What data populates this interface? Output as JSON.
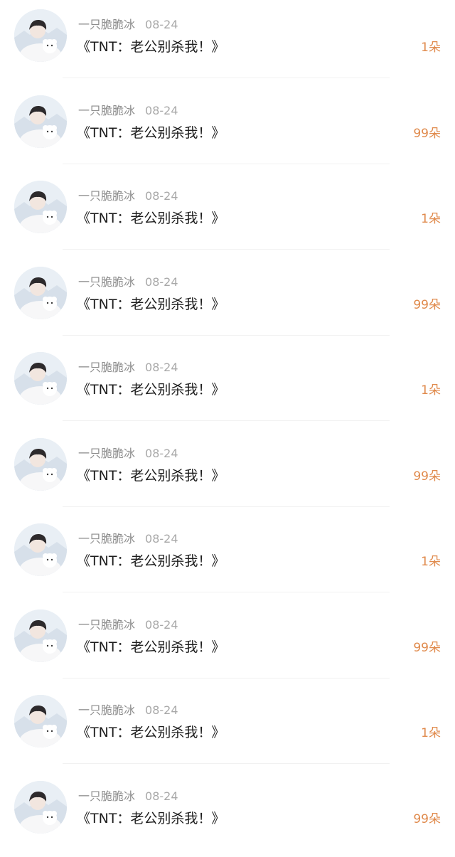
{
  "gift_list": {
    "avatar_icon": "user-avatar-photo",
    "accent_color": "#e08a4c",
    "items": [
      {
        "nickname": "一只脆脆冰",
        "date": "08-24",
        "title": "《TNT：老公别杀我！》",
        "gift": "1朵"
      },
      {
        "nickname": "一只脆脆冰",
        "date": "08-24",
        "title": "《TNT：老公别杀我！》",
        "gift": "99朵"
      },
      {
        "nickname": "一只脆脆冰",
        "date": "08-24",
        "title": "《TNT：老公别杀我！》",
        "gift": "1朵"
      },
      {
        "nickname": "一只脆脆冰",
        "date": "08-24",
        "title": "《TNT：老公别杀我！》",
        "gift": "99朵"
      },
      {
        "nickname": "一只脆脆冰",
        "date": "08-24",
        "title": "《TNT：老公别杀我！》",
        "gift": "1朵"
      },
      {
        "nickname": "一只脆脆冰",
        "date": "08-24",
        "title": "《TNT：老公别杀我！》",
        "gift": "99朵"
      },
      {
        "nickname": "一只脆脆冰",
        "date": "08-24",
        "title": "《TNT：老公别杀我！》",
        "gift": "1朵"
      },
      {
        "nickname": "一只脆脆冰",
        "date": "08-24",
        "title": "《TNT：老公别杀我！》",
        "gift": "99朵"
      },
      {
        "nickname": "一只脆脆冰",
        "date": "08-24",
        "title": "《TNT：老公别杀我！》",
        "gift": "1朵"
      },
      {
        "nickname": "一只脆脆冰",
        "date": "08-24",
        "title": "《TNT：老公别杀我！》",
        "gift": "99朵"
      }
    ]
  }
}
